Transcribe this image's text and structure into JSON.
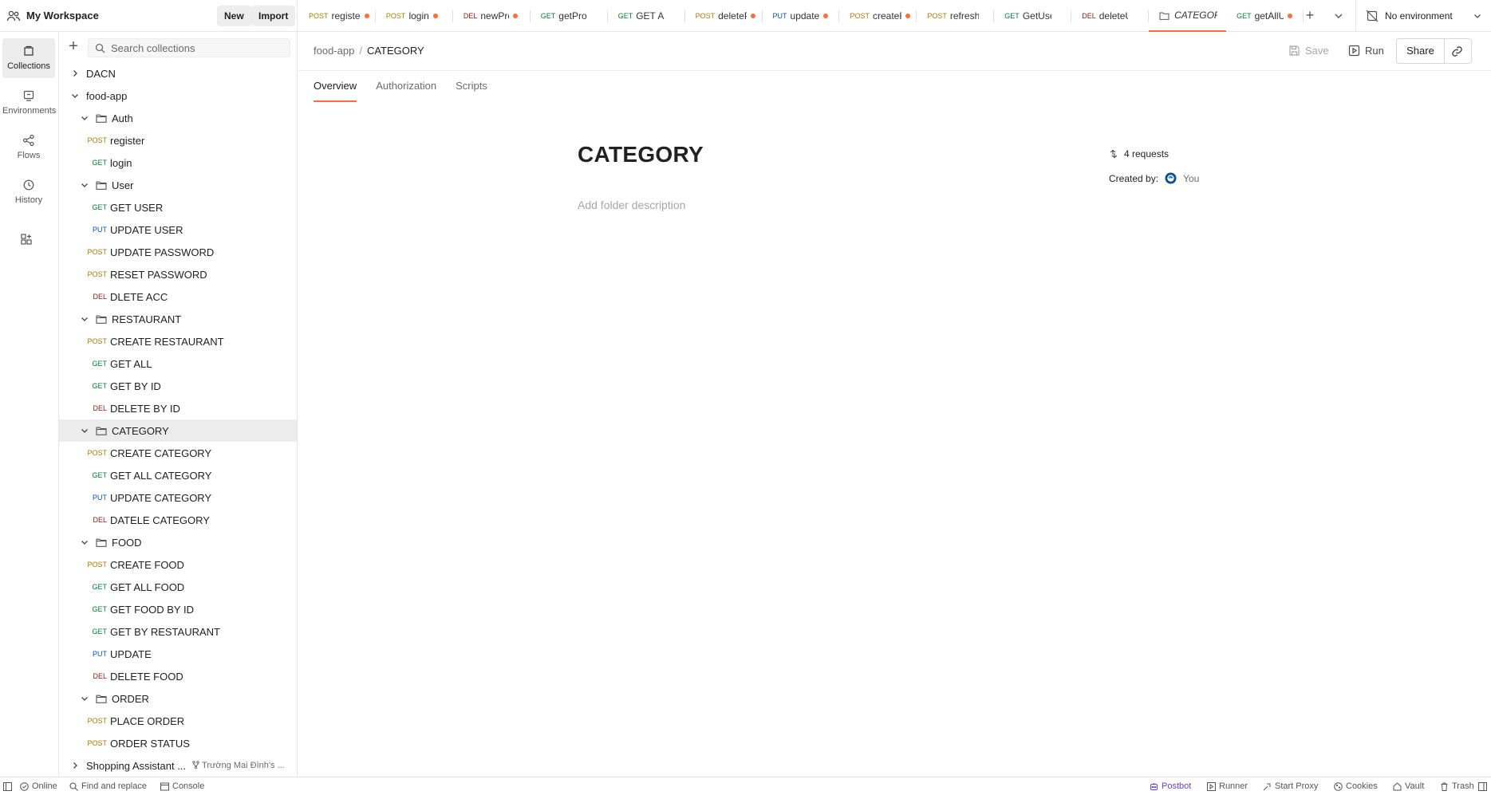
{
  "workspace": {
    "title": "My Workspace",
    "new_label": "New",
    "import_label": "Import"
  },
  "tabs": [
    {
      "method": "POST",
      "name": "registe",
      "unsaved": true
    },
    {
      "method": "POST",
      "name": "login",
      "unsaved": true
    },
    {
      "method": "DEL",
      "name": "newProd",
      "unsaved": true
    },
    {
      "method": "GET",
      "name": "getProdu",
      "unsaved": false
    },
    {
      "method": "GET",
      "name": "GET ALL I",
      "unsaved": false
    },
    {
      "method": "POST",
      "name": "deleteP",
      "unsaved": true
    },
    {
      "method": "PUT",
      "name": "updateP",
      "unsaved": true
    },
    {
      "method": "POST",
      "name": "createF",
      "unsaved": true
    },
    {
      "method": "POST",
      "name": "refresh-",
      "unsaved": false
    },
    {
      "method": "GET",
      "name": "GetUser",
      "unsaved": false
    },
    {
      "method": "DEL",
      "name": "deleteUs",
      "unsaved": false
    },
    {
      "method": "",
      "name": "CATEGOR",
      "unsaved": false,
      "active": true
    },
    {
      "method": "GET",
      "name": "getAllUs",
      "unsaved": true
    }
  ],
  "environment": {
    "label": "No environment"
  },
  "rail": [
    {
      "id": "collections",
      "label": "Collections",
      "active": true
    },
    {
      "id": "environments",
      "label": "Environments"
    },
    {
      "id": "flows",
      "label": "Flows"
    },
    {
      "id": "history",
      "label": "History"
    }
  ],
  "search": {
    "placeholder": "Search collections"
  },
  "tree": [
    {
      "type": "collection",
      "label": "DACN",
      "expanded": false
    },
    {
      "type": "collection",
      "label": "food-app",
      "expanded": true
    },
    {
      "type": "folder",
      "label": "Auth"
    },
    {
      "type": "request",
      "method": "POST",
      "label": "register"
    },
    {
      "type": "request",
      "method": "GET",
      "label": "login"
    },
    {
      "type": "folder",
      "label": "User"
    },
    {
      "type": "request",
      "method": "GET",
      "label": "GET USER"
    },
    {
      "type": "request",
      "method": "PUT",
      "label": "UPDATE USER"
    },
    {
      "type": "request",
      "method": "POST",
      "label": "UPDATE PASSWORD"
    },
    {
      "type": "request",
      "method": "POST",
      "label": "RESET PASSWORD"
    },
    {
      "type": "request",
      "method": "DEL",
      "label": "DLETE ACC"
    },
    {
      "type": "folder",
      "label": "RESTAURANT"
    },
    {
      "type": "request",
      "method": "POST",
      "label": "CREATE RESTAURANT"
    },
    {
      "type": "request",
      "method": "GET",
      "label": "GET ALL"
    },
    {
      "type": "request",
      "method": "GET",
      "label": "GET BY ID"
    },
    {
      "type": "request",
      "method": "DEL",
      "label": "DELETE BY ID"
    },
    {
      "type": "folder",
      "label": "CATEGORY",
      "selected": true
    },
    {
      "type": "request",
      "method": "POST",
      "label": "CREATE CATEGORY"
    },
    {
      "type": "request",
      "method": "GET",
      "label": "GET ALL CATEGORY"
    },
    {
      "type": "request",
      "method": "PUT",
      "label": "UPDATE CATEGORY"
    },
    {
      "type": "request",
      "method": "DEL",
      "label": "DATELE CATEGORY"
    },
    {
      "type": "folder",
      "label": "FOOD"
    },
    {
      "type": "request",
      "method": "POST",
      "label": "CREATE FOOD"
    },
    {
      "type": "request",
      "method": "GET",
      "label": "GET ALL FOOD"
    },
    {
      "type": "request",
      "method": "GET",
      "label": "GET FOOD BY ID"
    },
    {
      "type": "request",
      "method": "GET",
      "label": "GET BY RESTAURANT"
    },
    {
      "type": "request",
      "method": "PUT",
      "label": "UPDATE"
    },
    {
      "type": "request",
      "method": "DEL",
      "label": "DELETE FOOD"
    },
    {
      "type": "folder",
      "label": "ORDER"
    },
    {
      "type": "request",
      "method": "POST",
      "label": "PLACE ORDER"
    },
    {
      "type": "request",
      "method": "POST",
      "label": "ORDER STATUS"
    },
    {
      "type": "collection",
      "label": "Shopping Assistant ...",
      "expanded": false,
      "fork": "Trường Mai Đình's ..."
    }
  ],
  "breadcrumb": {
    "parent": "food-app",
    "separator": "/",
    "current": "CATEGORY"
  },
  "actions": {
    "save": "Save",
    "run": "Run",
    "share": "Share"
  },
  "subtabs": [
    {
      "label": "Overview",
      "active": true
    },
    {
      "label": "Authorization"
    },
    {
      "label": "Scripts"
    }
  ],
  "folder": {
    "title": "CATEGORY",
    "description_placeholder": "Add folder description",
    "requests": "4 requests",
    "created_by_label": "Created by:",
    "created_by": "You"
  },
  "status": {
    "online": "Online",
    "find_replace": "Find and replace",
    "console": "Console",
    "postbot": "Postbot",
    "runner": "Runner",
    "start_proxy": "Start Proxy",
    "cookies": "Cookies",
    "vault": "Vault",
    "trash": "Trash"
  },
  "colors": {
    "accent": "#ff6c37",
    "post": "#ad7a03",
    "get": "#007f31",
    "put": "#0053b8",
    "del": "#8e1a10",
    "postbot": "#6b3fd4"
  }
}
